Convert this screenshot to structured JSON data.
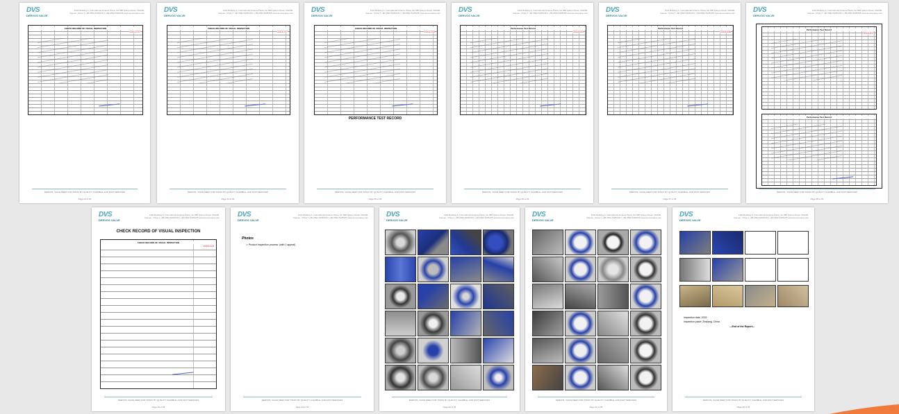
{
  "header": {
    "logo": "DVS",
    "logo_sub": "DERVOS VALVE",
    "address": "1201 Building A, International Finance Plaza, No.588 Qianpu Road, 361006, Xiamen, China  T +86-0592-5185136   F +86-0592-5185155   www.dervosvalve.com"
  },
  "footer_text": "DERVOS, VALVE MEET FOR TODAY BY QUALITY, FLEXIBLE, AND FAST SERVICES",
  "pages": {
    "p1": {
      "form_title": "CHECK RECORD OF VISUAL INSPECTION",
      "form_no": "0001797",
      "page": "Page 04 of 25"
    },
    "p2": {
      "form_title": "CHECK RECORD OF VISUAL INSPECTION",
      "form_no": "0001797",
      "page": "Page 04 of 25"
    },
    "p3": {
      "form_title": "CHECK RECORD OF VISUAL INSPECTION",
      "form_no": "0001793",
      "caption": "PERFORMANCE TEST RECORD",
      "page": "Page 05 of 25"
    },
    "p4": {
      "form_title": "Performance Test Record",
      "form_no": "0004493",
      "page": "Page 06 of 25"
    },
    "p5": {
      "form_title": "Performance Test Record",
      "form_no": "0004496",
      "page": "Page 07 of 25"
    },
    "p6": {
      "form_title": "Performance Test Record",
      "form_no": "0004497",
      "page": "Page 08 of 25"
    },
    "p7": {
      "title": "CHECK RECORD OF VISUAL INSPECTION",
      "form_title": "CHECK RECORD OF VISUAL INSPECTION",
      "form_no": "0004229",
      "page": "Page 10 of 25"
    },
    "p8": {
      "heading": "Photos",
      "bullet": "Product Inspection process: (with 1 appeal)",
      "page": "Page 19 of 25"
    },
    "p9": {
      "page": "Page 20 of 25"
    },
    "p10": {
      "page": "Page 21 of 25"
    },
    "p11": {
      "inspection_date": "Inspection date: 2022",
      "inspection_place": "Inspection place: Zhejiang, China",
      "end": "---End of the Report---",
      "page": "Page 25 of 25"
    }
  },
  "colors": {
    "brand": "#4aa6b8",
    "footer_line": "#8ab8c0",
    "form_no": "#cc3333",
    "valve_blue": "#2741a8"
  }
}
